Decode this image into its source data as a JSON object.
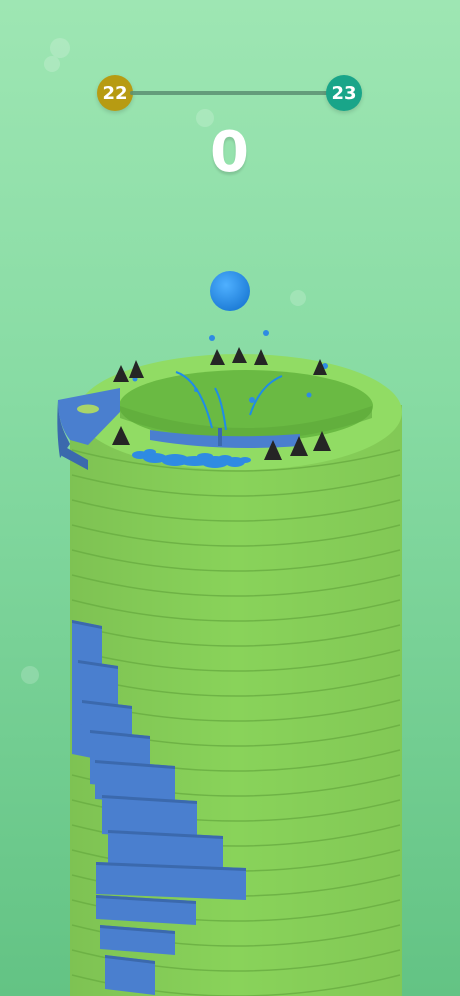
{
  "hud": {
    "level_current": "22",
    "level_next": "23",
    "progress": 0,
    "score": "0"
  },
  "colors": {
    "background_top": "#9ee6b3",
    "background_bottom": "#63c384",
    "safe_platform": "#8ed65e",
    "breakable_platform": "#4a7fcf",
    "ball": "#1f8ce6",
    "spike": "#252525",
    "level_current_badge": "#b79b12",
    "level_next_badge": "#19a589"
  },
  "objects": {
    "ball": "ball",
    "spikes": "spike-icon",
    "tower": "helix-tower",
    "splash": "paint-splash"
  }
}
